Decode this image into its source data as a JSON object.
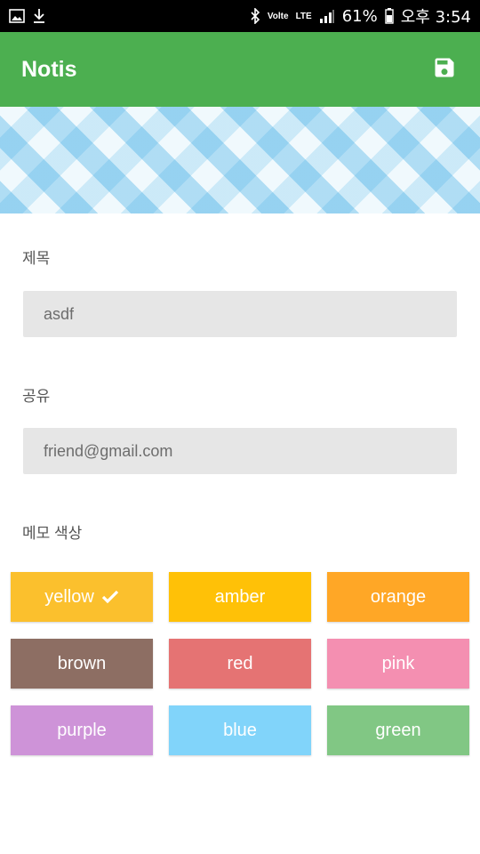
{
  "status_bar": {
    "battery": "61%",
    "time": "오후 3:54",
    "volte": "Volte",
    "network": "LTE",
    "icons": [
      "image-icon",
      "download-icon",
      "bluetooth-icon",
      "signal-icon",
      "battery-icon"
    ]
  },
  "app_bar": {
    "title": "Notis",
    "save_icon": "save-icon",
    "color": "#4caf50"
  },
  "form": {
    "title_label": "제목",
    "title_value": "asdf",
    "share_label": "공유",
    "share_value": "friend@gmail.com",
    "color_label": "메모 색상"
  },
  "colors": [
    {
      "label": "yellow",
      "hex": "#fbc02d",
      "selected": true
    },
    {
      "label": "amber",
      "hex": "#ffc107",
      "selected": false
    },
    {
      "label": "orange",
      "hex": "#ffa726",
      "selected": false
    },
    {
      "label": "brown",
      "hex": "#8d6e63",
      "selected": false
    },
    {
      "label": "red",
      "hex": "#e57373",
      "selected": false
    },
    {
      "label": "pink",
      "hex": "#f48fb1",
      "selected": false
    },
    {
      "label": "purple",
      "hex": "#ce93d8",
      "selected": false
    },
    {
      "label": "blue",
      "hex": "#81d4fa",
      "selected": false
    },
    {
      "label": "green",
      "hex": "#81c784",
      "selected": false
    }
  ]
}
